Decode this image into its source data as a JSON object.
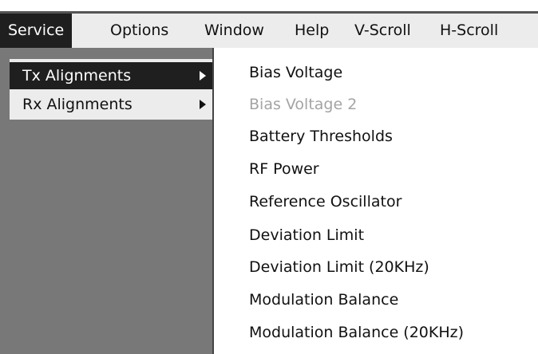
{
  "menubar": {
    "items": [
      {
        "label": "Service",
        "active": true
      },
      {
        "label": "Options"
      },
      {
        "label": "Window"
      },
      {
        "label": "Help"
      },
      {
        "label": "V-Scroll"
      },
      {
        "label": "H-Scroll"
      }
    ]
  },
  "service_menu": {
    "items": [
      {
        "label": "Tx Alignments",
        "active": true,
        "has_submenu": true
      },
      {
        "label": "Rx Alignments",
        "has_submenu": true
      }
    ]
  },
  "tx_submenu": {
    "items": [
      {
        "label": "Bias Voltage"
      },
      {
        "label": "Bias Voltage 2",
        "disabled": true
      },
      {
        "label": "Battery Thresholds"
      },
      {
        "label": "RF Power"
      },
      {
        "label": "Reference Oscillator"
      },
      {
        "label": "Deviation Limit"
      },
      {
        "label": "Deviation Limit (20KHz)"
      },
      {
        "label": "Modulation Balance"
      },
      {
        "label": "Modulation Balance (20KHz)"
      }
    ]
  },
  "colors": {
    "menu_bg": "#ececec",
    "highlight_bg": "#1f1f1f",
    "disabled_text": "#a4a4a4",
    "backdrop": "#7a7a7a"
  }
}
